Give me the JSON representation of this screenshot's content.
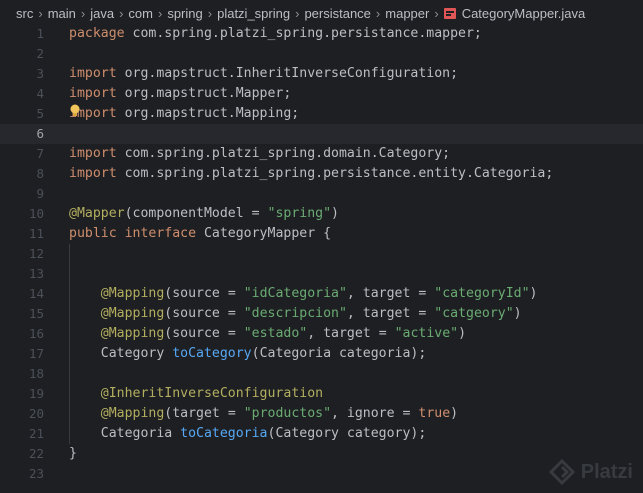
{
  "breadcrumb": {
    "items": [
      "src",
      "main",
      "java",
      "com",
      "spring",
      "platzi_spring",
      "persistance",
      "mapper"
    ],
    "file": "CategoryMapper.java"
  },
  "editor": {
    "current_line": 6,
    "lines": [
      {
        "n": "1",
        "tokens": [
          [
            "kw",
            "package "
          ],
          [
            "pl",
            "com.spring.platzi_spring.persistance.mapper;"
          ]
        ]
      },
      {
        "n": "2",
        "tokens": []
      },
      {
        "n": "3",
        "tokens": [
          [
            "kw",
            "import "
          ],
          [
            "pl",
            "org.mapstruct.InheritInverseConfiguration;"
          ]
        ]
      },
      {
        "n": "4",
        "tokens": [
          [
            "kw",
            "import "
          ],
          [
            "pl",
            "org.mapstruct.Mapper;"
          ]
        ]
      },
      {
        "n": "5",
        "tokens": [
          [
            "kw",
            "import "
          ],
          [
            "pl",
            "org.mapstruct.Mapping;"
          ]
        ]
      },
      {
        "n": "6",
        "tokens": []
      },
      {
        "n": "7",
        "tokens": [
          [
            "kw",
            "import "
          ],
          [
            "pl",
            "com.spring.platzi_spring.domain.Category;"
          ]
        ]
      },
      {
        "n": "8",
        "tokens": [
          [
            "kw",
            "import "
          ],
          [
            "pl",
            "com.spring.platzi_spring.persistance.entity.Categoria;"
          ]
        ]
      },
      {
        "n": "9",
        "tokens": []
      },
      {
        "n": "10",
        "tokens": [
          [
            "ann",
            "@Mapper"
          ],
          [
            "pl",
            "(componentModel = "
          ],
          [
            "str",
            "\"spring\""
          ],
          [
            "pl",
            ")"
          ]
        ]
      },
      {
        "n": "11",
        "tokens": [
          [
            "kw",
            "public interface "
          ],
          [
            "pl",
            "CategoryMapper {"
          ]
        ]
      },
      {
        "n": "12",
        "tokens": []
      },
      {
        "n": "13",
        "tokens": []
      },
      {
        "n": "14",
        "tokens": [
          [
            "pl",
            "    "
          ],
          [
            "ann",
            "@Mapping"
          ],
          [
            "pl",
            "(source = "
          ],
          [
            "str",
            "\"idCategoria\""
          ],
          [
            "pl",
            ", target = "
          ],
          [
            "str",
            "\"categoryId\""
          ],
          [
            "pl",
            ")"
          ]
        ]
      },
      {
        "n": "15",
        "tokens": [
          [
            "pl",
            "    "
          ],
          [
            "ann",
            "@Mapping"
          ],
          [
            "pl",
            "(source = "
          ],
          [
            "str",
            "\"descripcion\""
          ],
          [
            "pl",
            ", target = "
          ],
          [
            "str",
            "\"catgeory\""
          ],
          [
            "pl",
            ")"
          ]
        ]
      },
      {
        "n": "16",
        "tokens": [
          [
            "pl",
            "    "
          ],
          [
            "ann",
            "@Mapping"
          ],
          [
            "pl",
            "(source = "
          ],
          [
            "str",
            "\"estado\""
          ],
          [
            "pl",
            ", target = "
          ],
          [
            "str",
            "\"active\""
          ],
          [
            "pl",
            ")"
          ]
        ]
      },
      {
        "n": "17",
        "tokens": [
          [
            "pl",
            "    Category "
          ],
          [
            "prm",
            "toCategory"
          ],
          [
            "pl",
            "(Categoria categoria);"
          ]
        ]
      },
      {
        "n": "18",
        "tokens": []
      },
      {
        "n": "19",
        "tokens": [
          [
            "pl",
            "    "
          ],
          [
            "ann",
            "@InheritInverseConfiguration"
          ]
        ]
      },
      {
        "n": "20",
        "tokens": [
          [
            "pl",
            "    "
          ],
          [
            "ann",
            "@Mapping"
          ],
          [
            "pl",
            "(target = "
          ],
          [
            "str",
            "\"productos\""
          ],
          [
            "pl",
            ", ignore = "
          ],
          [
            "kw",
            "true"
          ],
          [
            "pl",
            ")"
          ]
        ]
      },
      {
        "n": "21",
        "tokens": [
          [
            "pl",
            "    Categoria "
          ],
          [
            "prm",
            "toCategoria"
          ],
          [
            "pl",
            "(Category category);"
          ]
        ]
      },
      {
        "n": "22",
        "tokens": [
          [
            "pl",
            "}"
          ]
        ]
      },
      {
        "n": "23",
        "tokens": []
      }
    ]
  },
  "watermark": {
    "text": "Platzi"
  }
}
